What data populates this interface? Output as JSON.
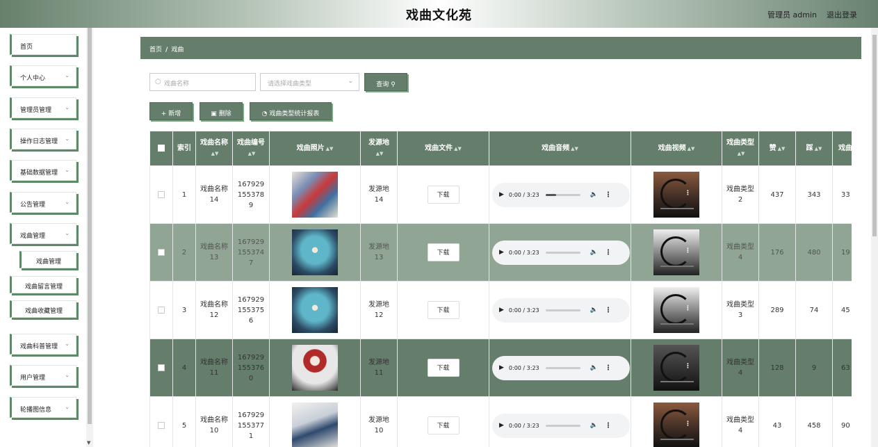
{
  "header": {
    "title": "戏曲文化苑",
    "user": "管理员 admin",
    "logout": "退出登录"
  },
  "sidebar": {
    "items": [
      {
        "label": "首页",
        "has_chevron": false
      },
      {
        "label": "个人中心",
        "has_chevron": true
      },
      {
        "label": "管理员管理",
        "has_chevron": true
      },
      {
        "label": "操作日志管理",
        "has_chevron": true
      },
      {
        "label": "基础数据管理",
        "has_chevron": true
      },
      {
        "label": "公告管理",
        "has_chevron": true
      },
      {
        "label": "戏曲管理",
        "has_chevron": true
      },
      {
        "label": "戏曲科普管理",
        "has_chevron": true
      },
      {
        "label": "用户管理",
        "has_chevron": true
      },
      {
        "label": "轮播图信息",
        "has_chevron": true
      }
    ],
    "subitems": [
      "戏曲管理",
      "戏曲留言管理",
      "戏曲收藏管理"
    ]
  },
  "breadcrumb": {
    "home": "首页",
    "separator": "/",
    "current": "戏曲"
  },
  "search": {
    "name_placeholder": "戏曲名称",
    "type_placeholder": "请选择戏曲类型",
    "query_label": "查询"
  },
  "actions": {
    "add": "新增",
    "delete": "删除",
    "stats": "戏曲类型统计报表"
  },
  "table": {
    "headers": [
      "索引",
      "戏曲名称",
      "戏曲编号",
      "戏曲照片",
      "发源地",
      "戏曲文件",
      "戏曲音频",
      "戏曲视频",
      "戏曲类型",
      "赞",
      "踩",
      "戏曲热度"
    ],
    "download_label": "下载",
    "rows": [
      {
        "index": "1",
        "name": "戏曲名称14",
        "code": "1679291553789",
        "origin": "发源地14",
        "audio_time": "0:00 / 3:23",
        "audio_progress": 0.3,
        "type": "戏曲类型2",
        "like": "437",
        "dislike": "343",
        "heat": "33"
      },
      {
        "index": "2",
        "name": "戏曲名称13",
        "code": "1679291553747",
        "origin": "发源地13",
        "audio_time": "0:00 / 3:23",
        "audio_progress": 0,
        "type": "戏曲类型4",
        "like": "176",
        "dislike": "480",
        "heat": "19"
      },
      {
        "index": "3",
        "name": "戏曲名称12",
        "code": "1679291553756",
        "origin": "发源地12",
        "audio_time": "0:00 / 3:23",
        "audio_progress": 0,
        "type": "戏曲类型3",
        "like": "289",
        "dislike": "74",
        "heat": "45"
      },
      {
        "index": "4",
        "name": "戏曲名称11",
        "code": "1679291553760",
        "origin": "发源地11",
        "audio_time": "0:00 / 3:23",
        "audio_progress": 0,
        "type": "戏曲类型4",
        "like": "128",
        "dislike": "9",
        "heat": "63"
      },
      {
        "index": "5",
        "name": "戏曲名称10",
        "code": "1679291553771",
        "origin": "发源地10",
        "audio_time": "0:00 / 3:23",
        "audio_progress": 0,
        "type": "戏曲类型4",
        "like": "43",
        "dislike": "458",
        "heat": "90"
      }
    ]
  },
  "icons": {
    "search": "search-icon",
    "chevron": "chevron-down-icon",
    "sort": "sort-icon",
    "play": "play-icon",
    "volume": "volume-icon",
    "more": "more-vertical-icon"
  },
  "colors": {
    "primary": "#657e6b",
    "row_alt": "#90a593",
    "accent": "#5d8a66"
  }
}
